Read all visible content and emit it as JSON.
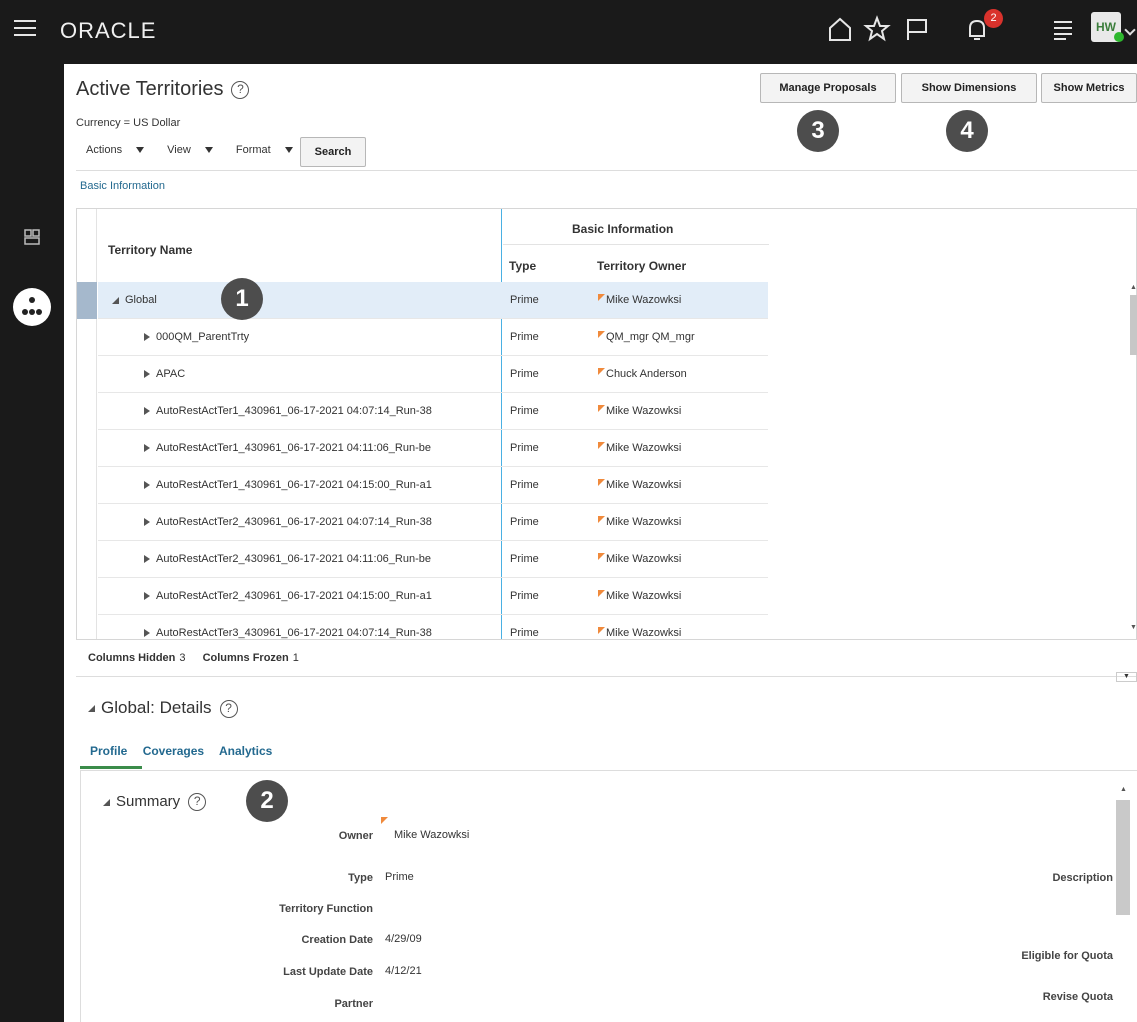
{
  "header": {
    "brand": "ORACLE",
    "notification_count": "2",
    "avatar_initials": "HW"
  },
  "page": {
    "title": "Active Territories",
    "help": "?",
    "currency": "Currency = US Dollar",
    "menus": {
      "actions": "Actions",
      "view": "View",
      "format": "Format"
    },
    "search_label": "Search",
    "buttons": {
      "manage_proposals": "Manage Proposals",
      "show_dimensions": "Show Dimensions",
      "show_metrics": "Show Metrics"
    },
    "basic_information_link": "Basic Information"
  },
  "table": {
    "group_header": "Basic Information",
    "columns": {
      "name": "Territory Name",
      "type": "Type",
      "owner": "Territory Owner"
    },
    "rows": [
      {
        "name": "Global",
        "type": "Prime",
        "owner": "Mike Wazowksi"
      },
      {
        "name": "000QM_ParentTrty",
        "type": "Prime",
        "owner": "QM_mgr QM_mgr"
      },
      {
        "name": "APAC",
        "type": "Prime",
        "owner": "Chuck Anderson"
      },
      {
        "name": "AutoRestActTer1_430961_06-17-2021 04:07:14_Run-38",
        "type": "Prime",
        "owner": "Mike Wazowksi"
      },
      {
        "name": "AutoRestActTer1_430961_06-17-2021 04:11:06_Run-be",
        "type": "Prime",
        "owner": "Mike Wazowksi"
      },
      {
        "name": "AutoRestActTer1_430961_06-17-2021 04:15:00_Run-a1",
        "type": "Prime",
        "owner": "Mike Wazowksi"
      },
      {
        "name": "AutoRestActTer2_430961_06-17-2021 04:07:14_Run-38",
        "type": "Prime",
        "owner": "Mike Wazowksi"
      },
      {
        "name": "AutoRestActTer2_430961_06-17-2021 04:11:06_Run-be",
        "type": "Prime",
        "owner": "Mike Wazowksi"
      },
      {
        "name": "AutoRestActTer2_430961_06-17-2021 04:15:00_Run-a1",
        "type": "Prime",
        "owner": "Mike Wazowksi"
      },
      {
        "name": "AutoRestActTer3_430961_06-17-2021 04:07:14_Run-38",
        "type": "Prime",
        "owner": "Mike Wazowksi"
      }
    ],
    "status": {
      "hidden_label": "Columns Hidden",
      "hidden_count": "3",
      "frozen_label": "Columns Frozen",
      "frozen_count": "1"
    }
  },
  "details": {
    "title": "Global: Details",
    "tabs": {
      "profile": "Profile",
      "coverages": "Coverages",
      "analytics": "Analytics"
    },
    "summary_title": "Summary",
    "fields": {
      "owner_label": "Owner",
      "owner_value": "Mike Wazowksi",
      "type_label": "Type",
      "type_value": "Prime",
      "function_label": "Territory Function",
      "creation_label": "Creation Date",
      "creation_value": "4/29/09",
      "update_label": "Last Update Date",
      "update_value": "4/12/21",
      "partner_label": "Partner",
      "description_label": "Description",
      "eligible_label": "Eligible for Quota",
      "revise_label": "Revise Quota"
    }
  },
  "callouts": {
    "c1": "1",
    "c2": "2",
    "c3": "3",
    "c4": "4"
  }
}
